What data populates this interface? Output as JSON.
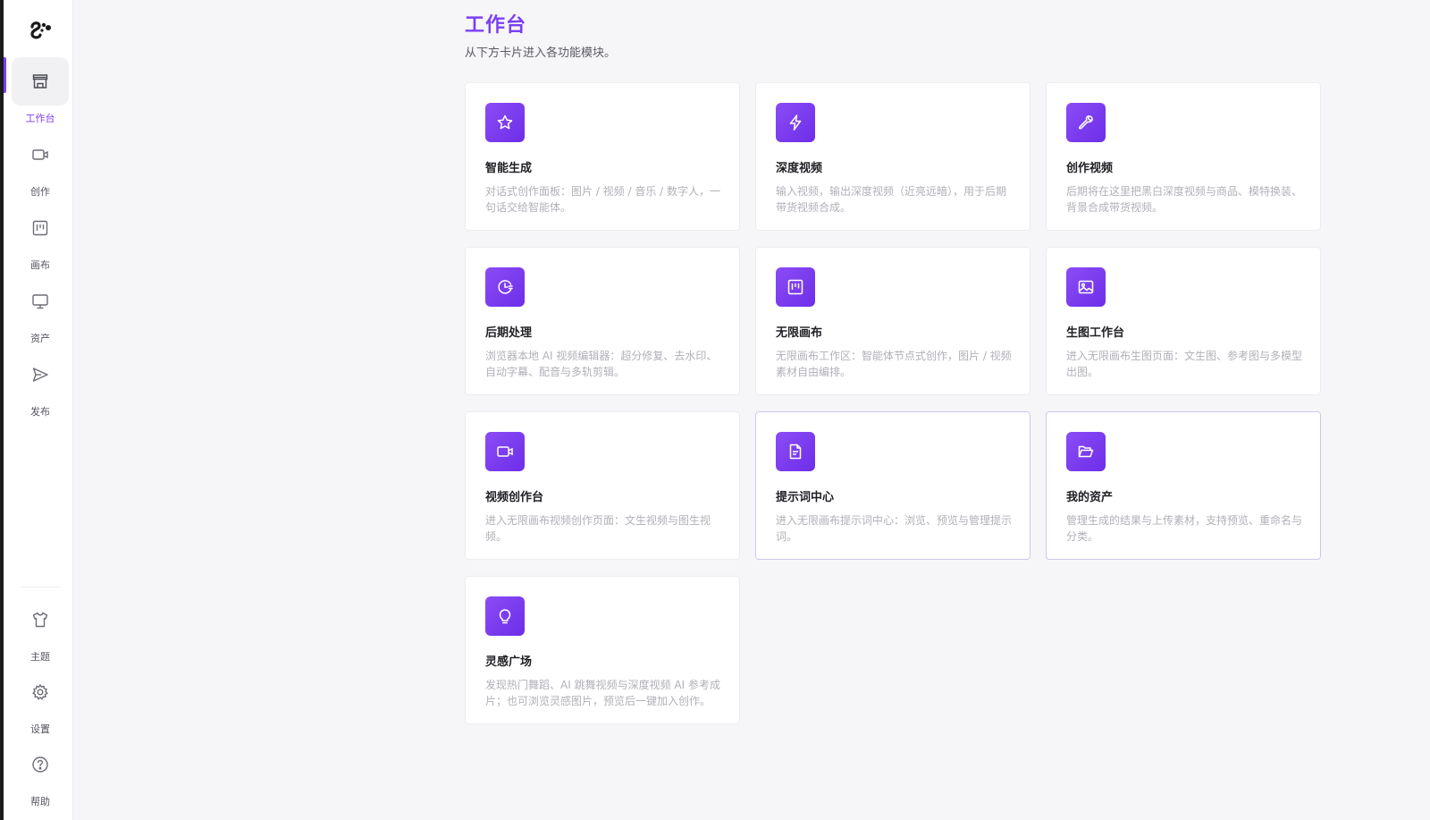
{
  "sidebar": {
    "logo_icon": "brand-logo",
    "items": [
      {
        "label": "工作台",
        "icon": "store-icon",
        "active": true
      },
      {
        "label": "创作",
        "icon": "video-camera-icon",
        "active": false
      },
      {
        "label": "画布",
        "icon": "canvas-icon",
        "active": false
      },
      {
        "label": "资产",
        "icon": "monitor-icon",
        "active": false
      },
      {
        "label": "发布",
        "icon": "send-icon",
        "active": false
      }
    ],
    "bottom_items": [
      {
        "label": "主题",
        "icon": "shirt-icon"
      },
      {
        "label": "设置",
        "icon": "gear-icon"
      },
      {
        "label": "帮助",
        "icon": "help-icon"
      }
    ],
    "accent_color": "#7b3ff2"
  },
  "main": {
    "title": "工作台",
    "subtitle": "从下方卡片进入各功能模块。",
    "cards": [
      {
        "title": "智能生成",
        "desc": "对话式创作面板：图片 / 视频 / 音乐 / 数字人，一句话交给智能体。",
        "icon": "star-icon"
      },
      {
        "title": "深度视频",
        "desc": "输入视频，输出深度视频（近亮远暗），用于后期带货视频合成。",
        "icon": "lightning-icon"
      },
      {
        "title": "创作视频",
        "desc": "后期将在这里把黑白深度视频与商品、模特换装、背景合成带货视频。",
        "icon": "wrench-icon"
      },
      {
        "title": "后期处理",
        "desc": "浏览器本地 AI 视频编辑器：超分修复、去水印、自动字幕、配音与多轨剪辑。",
        "icon": "clock-icon"
      },
      {
        "title": "无限画布",
        "desc": "无限画布工作区：智能体节点式创作，图片 / 视频素材自由编排。",
        "icon": "canvas-icon"
      },
      {
        "title": "生图工作台",
        "desc": "进入无限画布生图页面：文生图、参考图与多模型出图。",
        "icon": "image-icon"
      },
      {
        "title": "视频创作台",
        "desc": "进入无限画布视频创作页面：文生视频与图生视频。",
        "icon": "video-camera-icon"
      },
      {
        "title": "提示词中心",
        "desc": "进入无限画布提示词中心：浏览、预览与管理提示词。",
        "icon": "document-icon"
      },
      {
        "title": "我的资产",
        "desc": "管理生成的结果与上传素材，支持预览、重命名与分类。",
        "icon": "folder-open-icon"
      },
      {
        "title": "灵感广场",
        "desc": "发现热门舞蹈、AI 跳舞视频与深度视频 AI 参考成片；也可浏览灵感图片，预览后一键加入创作。",
        "icon": "lightbulb-icon"
      }
    ],
    "outlined_cards": [
      7,
      8
    ]
  }
}
